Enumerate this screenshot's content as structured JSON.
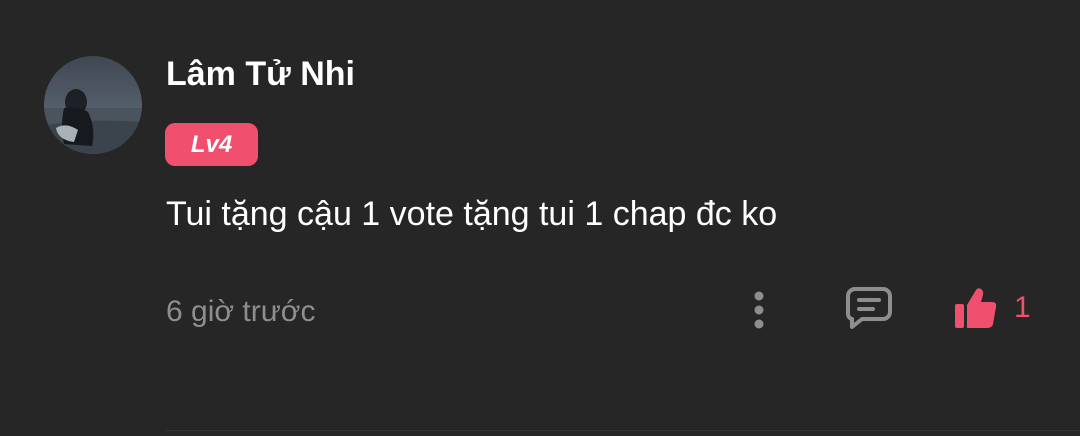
{
  "comment": {
    "user": {
      "name": "Lâm Tử Nhi",
      "level": "Lv4",
      "avatar_icon": "user-avatar-photo"
    },
    "text": "Tui tặng cậu 1 vote tặng tui 1 chap đc ko",
    "time_ago": "6 giờ trước",
    "actions": {
      "more_icon": "more-vertical-icon",
      "reply_icon": "comment-icon",
      "like_icon": "thumbs-up-icon",
      "like_count": "1"
    }
  },
  "colors": {
    "background": "#262626",
    "accent": "#f0506e",
    "text_primary": "#ffffff",
    "text_secondary": "#8e8e8e",
    "icon_gray": "#8e8e8e"
  }
}
